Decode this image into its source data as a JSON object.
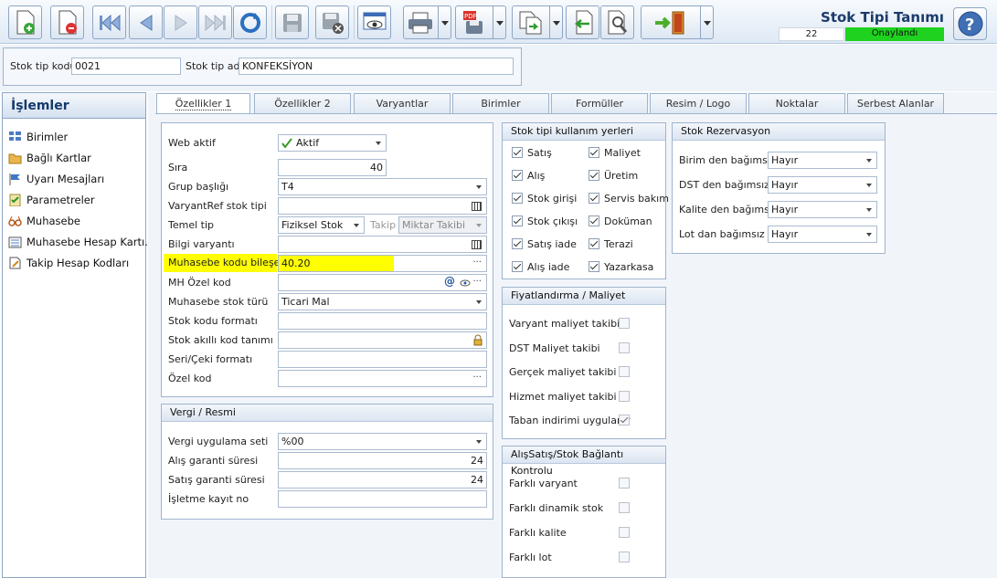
{
  "toolbar": {
    "screen_title": "Stok Tipi Tanımı",
    "record_count": "22",
    "status": "Onaylandı",
    "buttons": [
      "new-record",
      "delete-record",
      "first-record",
      "previous-record",
      "next-record",
      "last-record",
      "refresh",
      "save",
      "cancel",
      "preview",
      "print",
      "export-pdf",
      "copy",
      "import",
      "find-record",
      "exit"
    ]
  },
  "header": {
    "code_label": "Stok tip kodu",
    "code_value": "0021",
    "name_label": "Stok tip adı",
    "name_value": "KONFEKSİYON"
  },
  "sidebar": {
    "title": "İşlemler",
    "items": [
      {
        "label": "Birimler",
        "icon": "grid-icon"
      },
      {
        "label": "Bağlı Kartlar",
        "icon": "folder-icon"
      },
      {
        "label": "Uyarı Mesajları",
        "icon": "flag-icon"
      },
      {
        "label": "Parametreler",
        "icon": "checklist-icon"
      },
      {
        "label": "Muhasebe",
        "icon": "glasses-icon"
      },
      {
        "label": "Muhasebe Hesap Kartı...",
        "icon": "ledger-icon"
      },
      {
        "label": "Takip Hesap Kodları",
        "icon": "document-edit-icon"
      }
    ]
  },
  "tabs": [
    "Özellikler 1",
    "Özellikler 2",
    "Varyantlar",
    "Birimler",
    "Formüller",
    "Resim / Logo",
    "Noktalar",
    "Serbest Alanlar"
  ],
  "general": {
    "web_active_label": "Web aktif",
    "web_active_value": "Aktif",
    "sira_label": "Sıra",
    "sira_value": "40",
    "grup_label": "Grup başlığı",
    "grup_value": "T4",
    "varyantref_label": "VaryantRef stok tipi",
    "varyantref_value": "",
    "temel_tip_label": "Temel tip",
    "temel_tip_value": "Fiziksel Stok",
    "takip_label": "Takip",
    "takip_value": "Miktar Takibi",
    "bilgi_label": "Bilgi varyantı",
    "bilgi_value": "",
    "muh_kodu_label": "Muhasebe kodu bileşeni",
    "muh_kodu_value": "40.20",
    "mh_ozel_label": "MH Özel kod",
    "mh_ozel_value": "",
    "muh_turu_label": "Muhasebe stok türü",
    "muh_turu_value": "Ticari Mal",
    "stok_kodu_fmt_label": "Stok kodu formatı",
    "stok_kodu_fmt_value": "",
    "akilli_label": "Stok akıllı kod tanımı",
    "akilli_value": "",
    "seri_label": "Seri/Çeki formatı",
    "seri_value": "",
    "ozel_label": "Özel kod",
    "ozel_value": ""
  },
  "vergi": {
    "title": "Vergi / Resmi",
    "uygulama_label": "Vergi uygulama seti",
    "uygulama_value": "%00",
    "alis_label": "Alış garanti süresi",
    "alis_value": "24",
    "satis_label": "Satış garanti süresi",
    "satis_value": "24",
    "isletme_label": "İşletme kayıt no",
    "isletme_value": ""
  },
  "usage": {
    "title": "Stok tipi kullanım yerleri",
    "items": [
      {
        "label": "Satış",
        "checked": true
      },
      {
        "label": "Maliyet",
        "checked": true
      },
      {
        "label": "Alış",
        "checked": true
      },
      {
        "label": "Üretim",
        "checked": true
      },
      {
        "label": "Stok girişi",
        "checked": true
      },
      {
        "label": "Servis bakım",
        "checked": true
      },
      {
        "label": "Stok çıkışı",
        "checked": true
      },
      {
        "label": "Doküman",
        "checked": true
      },
      {
        "label": "Satış iade",
        "checked": true
      },
      {
        "label": "Terazi",
        "checked": true
      },
      {
        "label": "Alış iade",
        "checked": true
      },
      {
        "label": "Yazarkasa",
        "checked": true
      }
    ]
  },
  "pricing": {
    "title": "Fiyatlandırma / Maliyet",
    "items": [
      {
        "label": "Varyant maliyet takibi",
        "checked": false
      },
      {
        "label": "DST Maliyet takibi",
        "checked": false
      },
      {
        "label": "Gerçek maliyet takibi",
        "checked": false
      },
      {
        "label": "Hizmet maliyet takibi",
        "checked": false
      },
      {
        "label": "Taban indirimi uygulanır",
        "checked": true
      }
    ]
  },
  "control": {
    "title": "AlışSatış/Stok Bağlantı Kontrolu",
    "items": [
      {
        "label": "Farklı varyant",
        "checked": false
      },
      {
        "label": "Farklı dinamik stok",
        "checked": false
      },
      {
        "label": "Farklı kalite",
        "checked": false
      },
      {
        "label": "Farklı lot",
        "checked": false
      }
    ]
  },
  "reservation": {
    "title": "Stok Rezervasyon",
    "items": [
      {
        "label": "Birim den bağımsız",
        "value": "Hayır"
      },
      {
        "label": "DST den bağımsız",
        "value": "Hayır"
      },
      {
        "label": "Kalite den bağımsız",
        "value": "Hayır"
      },
      {
        "label": "Lot dan bağımsız",
        "value": "Hayır"
      }
    ]
  },
  "colors": {
    "status": "#1fd21f",
    "highlight": "#ffff00",
    "title": "#1b3b6a"
  }
}
